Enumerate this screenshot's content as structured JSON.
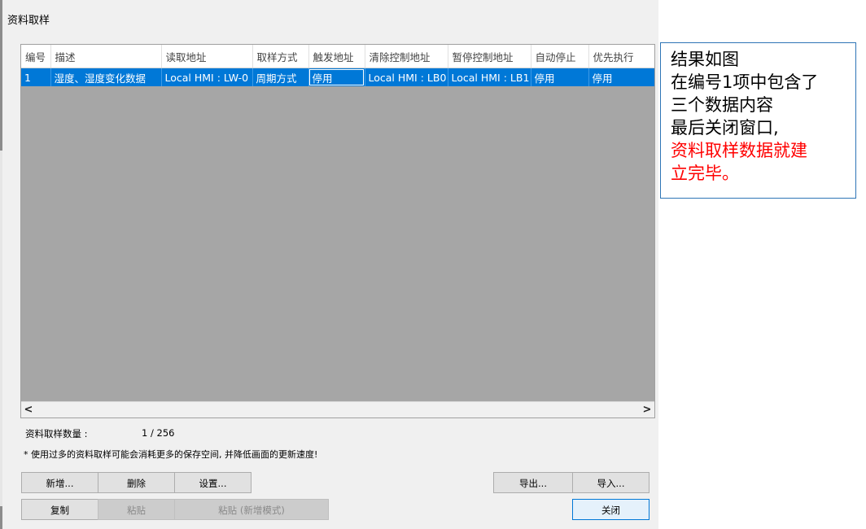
{
  "window": {
    "title": "资料取样"
  },
  "table": {
    "columns": [
      "编号",
      "描述",
      "读取地址",
      "取样方式",
      "触发地址",
      "清除控制地址",
      "暂停控制地址",
      "自动停止",
      "优先执行"
    ],
    "rows": [
      [
        "1",
        "湿度、湿度变化数据",
        "Local HMI : LW-0",
        "周期方式",
        "停用",
        "Local HMI : LB0",
        "Local HMI : LB1",
        "停用",
        "停用"
      ]
    ],
    "selected_row": 0,
    "focused_cell": 4
  },
  "scrollbar": {
    "left_arrow": "<",
    "right_arrow": ">"
  },
  "footer": {
    "count_label": "资料取样数量 :",
    "count_value": "1 / 256",
    "note": "* 使用过多的资料取样可能会消耗更多的保存空间, 并降低画面的更新速度!"
  },
  "buttons": {
    "add": "新增...",
    "delete": "删除",
    "settings": "设置...",
    "copy": "复制",
    "paste": "粘贴",
    "paste_append": "粘贴 (新增模式)",
    "export": "导出...",
    "import": "导入...",
    "close": "关闭"
  },
  "callout": {
    "lines": [
      "结果如图",
      "在编号1项中包含了",
      "三个数据内容",
      "最后关闭窗口,"
    ],
    "highlight_lines": [
      "资料取样数据就建",
      "立完毕。"
    ],
    "highlight_color": "#ff0000"
  },
  "colors": {
    "selection": "#0078d7",
    "grid_background": "#a6a6a6",
    "callout_border": "#2e75b6"
  }
}
